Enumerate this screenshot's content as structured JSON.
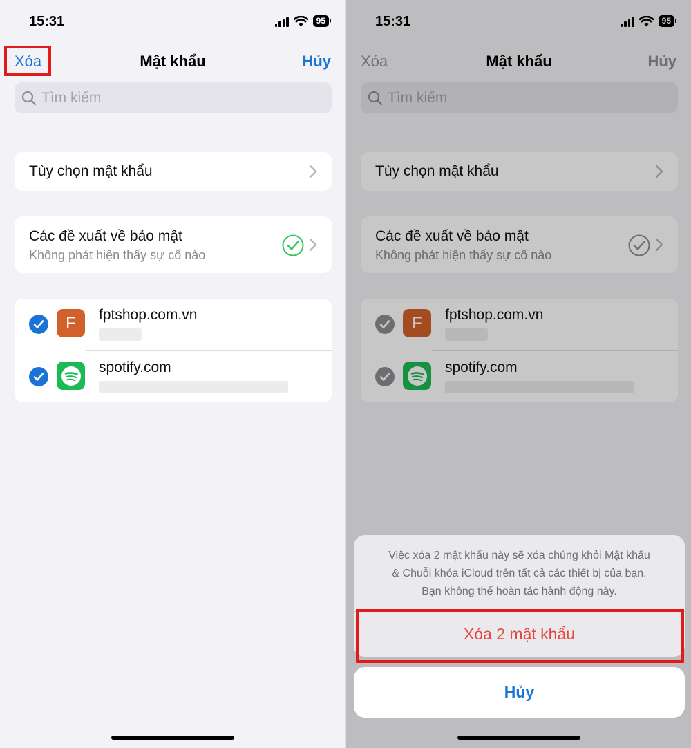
{
  "status_bar": {
    "time": "15:31",
    "battery": "95"
  },
  "nav": {
    "left_label": "Xóa",
    "title": "Mật khẩu",
    "right_label": "Hủy"
  },
  "search": {
    "placeholder": "Tìm kiếm"
  },
  "password_options": {
    "label": "Tùy chọn mật khẩu"
  },
  "security": {
    "title": "Các đề xuất về bảo mật",
    "subtitle": "Không phát hiện thấy sự cố nào"
  },
  "accounts": [
    {
      "site": "fptshop.com.vn",
      "icon_letter": "F",
      "icon": "fpt-logo-icon",
      "selected": true
    },
    {
      "site": "spotify.com",
      "icon_letter": "",
      "icon": "spotify-logo-icon",
      "selected": true
    }
  ],
  "action_sheet": {
    "message_lines": [
      "Việc xóa 2 mật khẩu này sẽ xóa chúng khỏi Mật khẩu",
      "& Chuỗi khóa iCloud trên tất cả các thiết bị của bạn.",
      "Bạn không thể hoàn tác hành động này."
    ],
    "delete_label": "Xóa 2 mật khẩu",
    "cancel_label": "Hủy"
  },
  "colors": {
    "accent": "#1a73d6",
    "destructive": "#e5483b",
    "highlight": "#e01b1b",
    "success": "#34c759",
    "fpt": "#d2602a",
    "spotify": "#1db954"
  }
}
